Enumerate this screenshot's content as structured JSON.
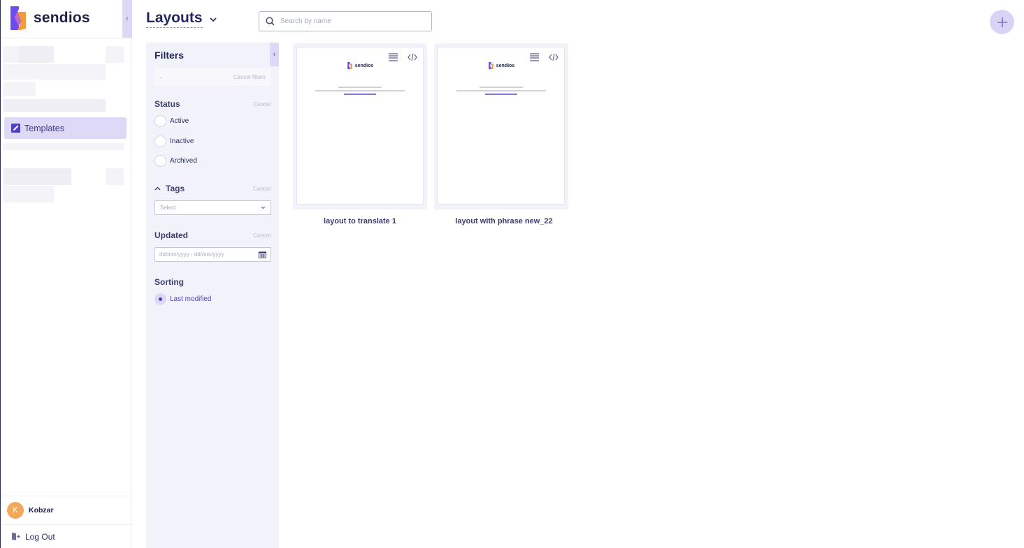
{
  "nav": {
    "brand": "sendios",
    "collapse_icon": "chevron-left-icon",
    "templates_label": "Templates",
    "user": {
      "initial": "K",
      "name": "Kobzar"
    },
    "logout_label": "Log Out"
  },
  "header": {
    "title": "Layouts",
    "search_placeholder": "Search by name"
  },
  "filters": {
    "title": "Filters",
    "chip_placeholder": "-",
    "cancel_filters": "Cancel filters",
    "status": {
      "label": "Status",
      "cancel": "Cancel",
      "options": [
        "Active",
        "Inactive",
        "Archived"
      ]
    },
    "tags": {
      "label": "Tags",
      "cancel": "Cancel",
      "select_placeholder": "Select"
    },
    "updated": {
      "label": "Updated",
      "cancel": "Cancel",
      "date_placeholder": "dd/mm/yyyy - dd/mm/yyyy"
    },
    "sorting": {
      "label": "Sorting",
      "selected": "Last modified"
    }
  },
  "layouts": [
    {
      "name": "layout to translate 1",
      "preview_brand": "sendios"
    },
    {
      "name": "layout with phrase new_22",
      "preview_brand": "sendios"
    }
  ],
  "colors": {
    "accent": "#4b3fc7",
    "accent_light": "#ddd8f6",
    "panel_bg": "#f2f3fa",
    "logo_purple": "#6c4cf0",
    "logo_orange": "#f39a3c"
  }
}
